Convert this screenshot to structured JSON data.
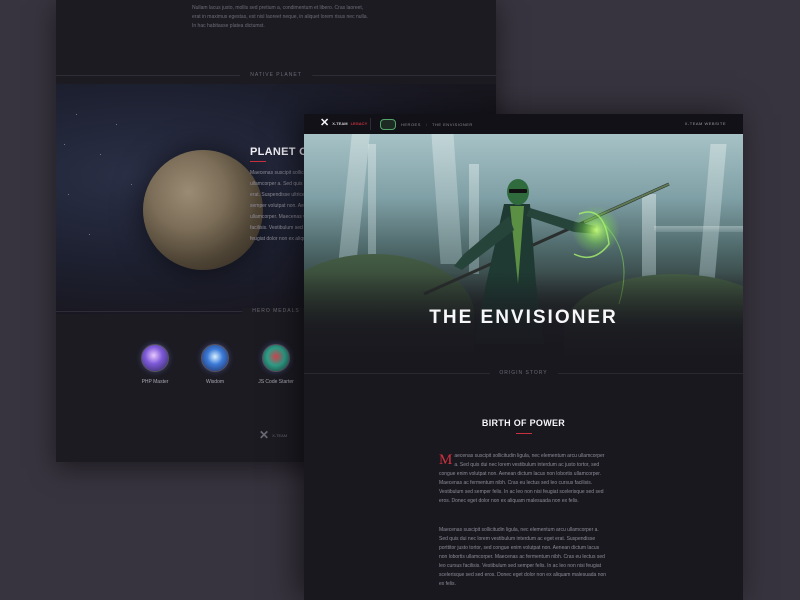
{
  "back_page": {
    "intro_text": "Nullam lacus justo, mollis sed pretium a, condimentum et libero. Cras laoreet, erat in maximus egestas, est nisl laoreet neque, in aliquet lorem risus nec nulla. In hac habitasse platea dictumst.",
    "native_planet_label": "NATIVE PLANET",
    "planet_title": "PLANET OF",
    "planet_text": "Maecenas suscipit sollicitudin ullamcorper a. Sed quis ac eget erat. Suspendisse ultrices ornare semper volutpat non. Aenean ullamcorper. Maecenas vel lacus facilisis. Vestibulum sed leo non nisi feugiat dolor non ex aliquam",
    "hero_medals_label": "HERO MEDALS",
    "medals": [
      {
        "label": "PHP Master",
        "icon": "php-medal-icon"
      },
      {
        "label": "Wisdom",
        "icon": "wisdom-medal-icon"
      },
      {
        "label": "JS Code Starter",
        "icon": "js-medal-icon"
      }
    ],
    "footer_logo_text": "X-TEAM"
  },
  "front_page": {
    "topbar": {
      "logo_team": "X-TEAM",
      "logo_legacy": "LEGACY",
      "crumb_heroes": "HEROES",
      "crumb_separator": "/",
      "crumb_current": "THE ENVISIONER",
      "right_link": "X-TEAM WEBSITE"
    },
    "hero_title": "THE ENVISIONER",
    "origin_story_label": "ORIGIN STORY",
    "story_title": "BIRTH OF POWER",
    "dropcap": "M",
    "paragraph1": "aecenas suscipit sollicitudin ligula, nec elementum arcu ullamcorper a. Sed quis dui nec lorem vestibulum interdum ac justo tortor, sed congue enim volutpat non. Aenean dictum lacus non lobortis ullamcorper. Maecenas ac fermentum nibh. Cras eu lectus sed leo cursus facilisis. Vestibulum sed semper felis. In ac leo non nisi feugiat scelerisque sed sed eros. Donec eget dolor non ex aliquam malesuada non ex felis.",
    "paragraph2": "Maecenas suscipit sollicitudin ligula, nec elementum arcu ullamcorper a. Sed quis dui nec lorem vestibulum interdum ac eget erat. Suspendisse porttitor justo tortor, sed congue enim volutpat non. Aenean dictum lacus non lobortis ullamcorper. Maecenas ac fermentum nibh. Cras eu lectus sed leo cursus facilisis. Vestibulum sed semper felis. In ac leo non nisi feugiat scelerisque sed sed eros. Donec eget dolor non ex aliquam malesuada non ex felis."
  },
  "colors": {
    "background": "#38343f",
    "page": "#19181f",
    "accent_red": "#c6303f",
    "energy_green": "#8cf05a"
  }
}
